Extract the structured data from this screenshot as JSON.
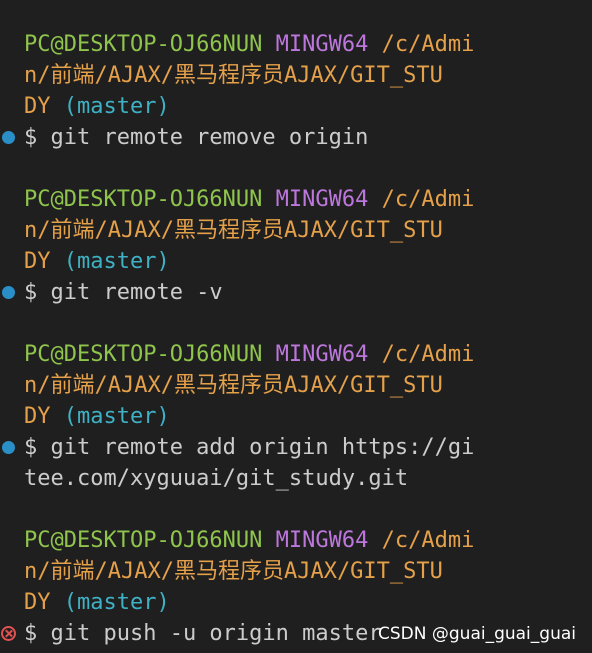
{
  "terminal": {
    "blocks": [
      {
        "prompt_user": "PC@DESKTOP-OJ66NUN",
        "prompt_host": "MINGW64",
        "path_line1": "/c/Admi",
        "path_line2": "n/前端/AJAX/黑马程序员AJAX/GIT_STU",
        "path_line3": "DY",
        "branch": "(master)",
        "status_icon": "circle-filled-icon",
        "command_line1": "$ git remote remove origin"
      },
      {
        "prompt_user": "PC@DESKTOP-OJ66NUN",
        "prompt_host": "MINGW64",
        "path_line1": "/c/Admi",
        "path_line2": "n/前端/AJAX/黑马程序员AJAX/GIT_STU",
        "path_line3": "DY",
        "branch": "(master)",
        "status_icon": "circle-filled-icon",
        "command_line1": "$ git remote -v"
      },
      {
        "prompt_user": "PC@DESKTOP-OJ66NUN",
        "prompt_host": "MINGW64",
        "path_line1": "/c/Admi",
        "path_line2": "n/前端/AJAX/黑马程序员AJAX/GIT_STU",
        "path_line3": "DY",
        "branch": "(master)",
        "status_icon": "circle-filled-icon",
        "command_line1": "$ git remote add origin https://gi",
        "command_line2": "tee.com/xyguuai/git_study.git"
      },
      {
        "prompt_user": "PC@DESKTOP-OJ66NUN",
        "prompt_host": "MINGW64",
        "path_line1": "/c/Admi",
        "path_line2": "n/前端/AJAX/黑马程序员AJAX/GIT_STU",
        "path_line3": "DY",
        "branch": "(master)",
        "status_icon": "error-circle-x-icon",
        "command_line1": "$ git push -u origin master"
      }
    ]
  },
  "watermark": "CSDN @guai_guai_guai",
  "colors": {
    "background": "#1f1f1f",
    "user": "#8fc54c",
    "host": "#bd77dc",
    "path": "#e5a04a",
    "branch": "#3fb1c5",
    "command": "#cccccc",
    "success_decoration": "#2a8fc7",
    "error_decoration": "#e05252"
  }
}
